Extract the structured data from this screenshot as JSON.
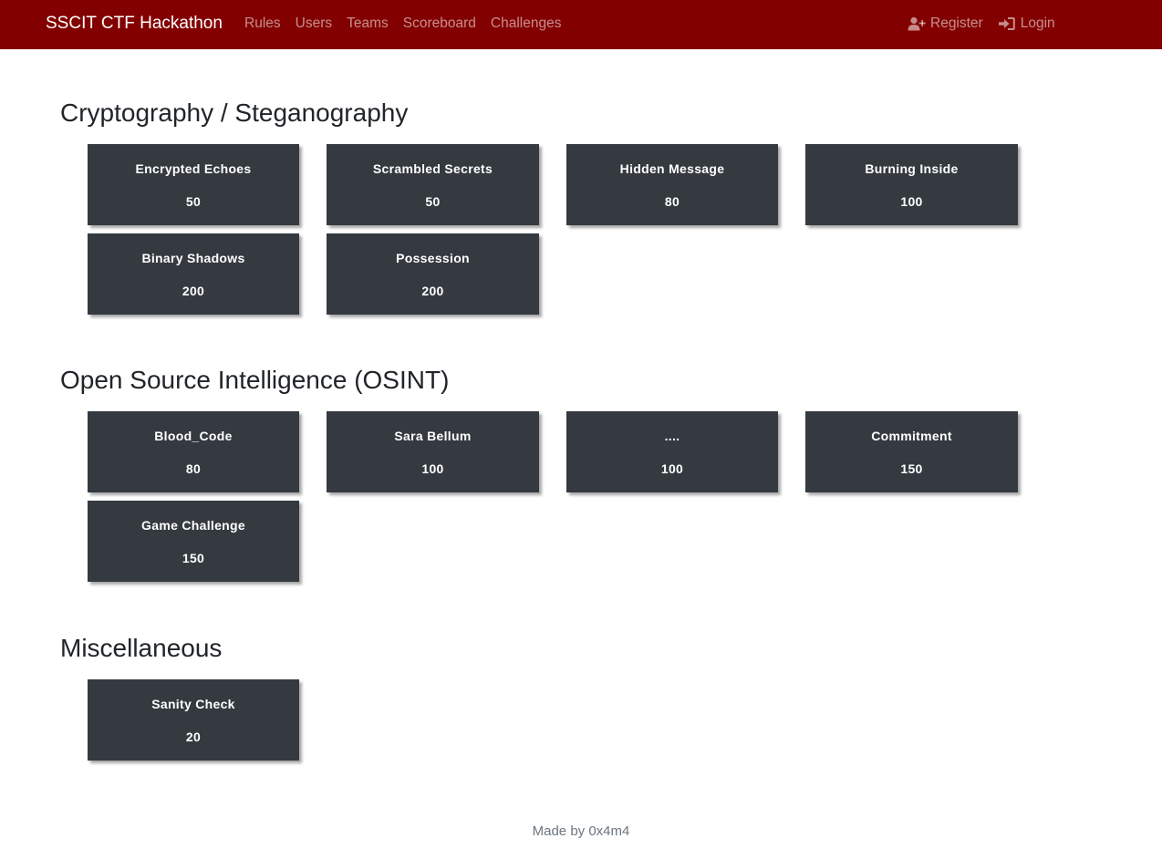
{
  "navbar": {
    "brand": "SSCIT CTF Hackathon",
    "links": [
      "Rules",
      "Users",
      "Teams",
      "Scoreboard",
      "Challenges"
    ],
    "register_label": "Register",
    "login_label": "Login",
    "register_icon": "user-plus-icon",
    "login_icon": "sign-in-icon",
    "background_color": "#830000"
  },
  "categories": [
    {
      "title": "Cryptography / Steganography",
      "challenges": [
        {
          "name": "Encrypted Echoes",
          "value": "50"
        },
        {
          "name": "Scrambled Secrets",
          "value": "50"
        },
        {
          "name": "Hidden Message",
          "value": "80"
        },
        {
          "name": "Burning Inside",
          "value": "100"
        },
        {
          "name": "Binary Shadows",
          "value": "200"
        },
        {
          "name": "Possession",
          "value": "200"
        }
      ]
    },
    {
      "title": "Open Source Intelligence (OSINT)",
      "challenges": [
        {
          "name": "Blood_Code",
          "value": "80"
        },
        {
          "name": "Sara Bellum",
          "value": "100"
        },
        {
          "name": "....",
          "value": "100"
        },
        {
          "name": "Commitment",
          "value": "150"
        },
        {
          "name": "Game Challenge",
          "value": "150"
        }
      ]
    },
    {
      "title": "Miscellaneous",
      "challenges": [
        {
          "name": "Sanity Check",
          "value": "20"
        }
      ]
    }
  ],
  "footer": {
    "text": "Made by 0x4m4"
  },
  "colors": {
    "card_background": "#343a40",
    "card_text": "#ffffff"
  }
}
